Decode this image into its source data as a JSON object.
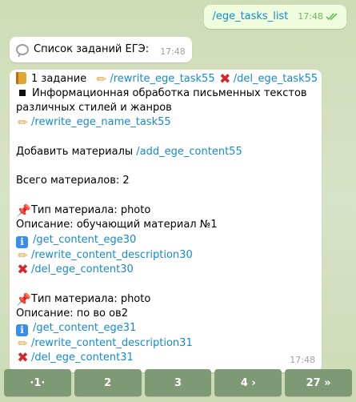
{
  "outgoing": {
    "text": "/ege_tasks_list",
    "time": "17:48"
  },
  "header_message": {
    "text": "Список заданий ЕГЭ:",
    "time": "17:48"
  },
  "task_message": {
    "task_title": "1 задание",
    "rewrite_cmd": "/rewrite_ege_task55",
    "delete_cmd": "/del_ege_task55",
    "task_name": "Информационная обработка письменных текстов различных стилей и жанров",
    "rewrite_name_cmd": "/rewrite_ege_name_task55",
    "add_label": "Добавить материалы",
    "add_cmd": "/add_ege_content55",
    "total_materials": "Всего материалов: 2",
    "materials": [
      {
        "type": "Тип материала: photo",
        "description": "Описание: обучающий материал №1",
        "get_cmd": "/get_content_ege30",
        "rewrite_cmd": "/rewrite_content_description30",
        "delete_cmd": "/del_ege_content30"
      },
      {
        "type": "Тип материала: photo",
        "description": "Описание: по во ов2",
        "get_cmd": "/get_content_ege31",
        "rewrite_cmd": "/rewrite_content_description31",
        "delete_cmd": "/del_ege_content31"
      }
    ],
    "time": "17:48"
  },
  "keyboard": [
    "·1·",
    "2",
    "3",
    "4 ›",
    "27 »"
  ],
  "icons": {
    "header": "speech-bubble-icon",
    "task": "book-icon",
    "rewrite": "pencil-icon",
    "delete": "cross-icon",
    "task_name_marker": "black-square-icon",
    "get": "info-icon",
    "material": "pushpin-icon"
  },
  "colors": {
    "link": "#168acd",
    "outgoing_bubble": "#effdde",
    "keyboard": "#7d9a74",
    "delete": "#d6262a"
  }
}
